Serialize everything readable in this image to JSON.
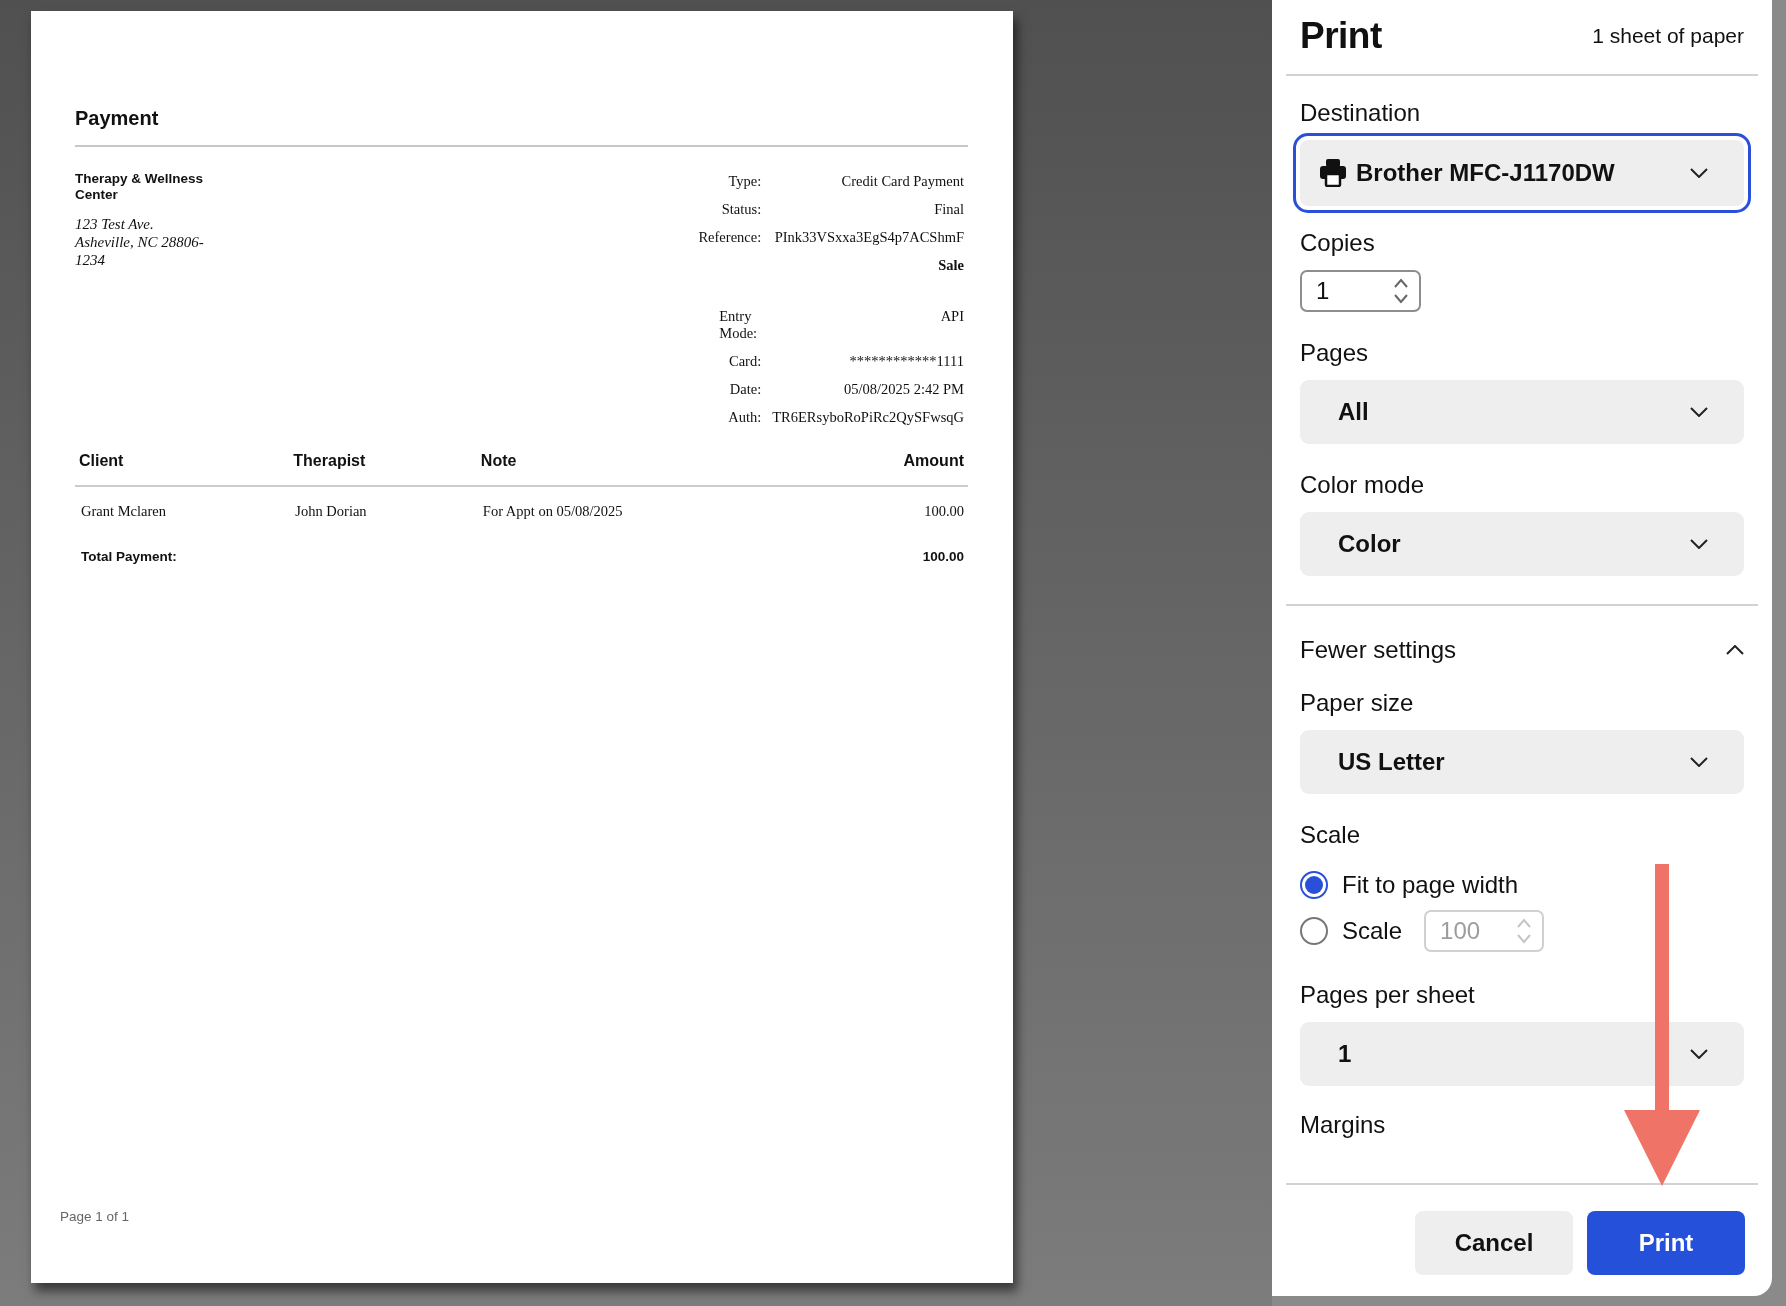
{
  "preview": {
    "document": {
      "title": "Payment",
      "business": {
        "name": "Therapy & Wellness Center",
        "address": [
          "123 Test Ave.",
          "Asheville, NC 28806-1234"
        ]
      },
      "details": [
        {
          "kind": "pair",
          "label": "Type:",
          "value": "Credit Card Payment"
        },
        {
          "kind": "pair",
          "label": "Status:",
          "value": "Final"
        },
        {
          "kind": "pair",
          "label": "Reference:",
          "value": "PInk33VSxxa3EgS4p7ACShmF"
        },
        {
          "kind": "heading",
          "value": "Sale"
        },
        {
          "kind": "pair",
          "label": "Entry Mode:",
          "value": "API"
        },
        {
          "kind": "pair",
          "label": "Card:",
          "value": "************1111"
        },
        {
          "kind": "pair",
          "label": "Date:",
          "value": "05/08/2025 2:42 PM"
        },
        {
          "kind": "pair",
          "label": "Auth:",
          "value": "TR6ERsyboRoPiRc2QySFwsqG"
        }
      ],
      "table": {
        "columns": [
          "Client",
          "Therapist",
          "Note",
          "Amount"
        ],
        "rows": [
          [
            "Grant Mclaren",
            "John Dorian",
            "For Appt on 05/08/2025",
            "100.00"
          ]
        ],
        "total": {
          "label": "Total Payment:",
          "value": "100.00"
        }
      },
      "footer": "Page 1 of 1"
    }
  },
  "panel": {
    "title": "Print",
    "sheet_count": "1 sheet of paper",
    "settings": [
      {
        "kind": "destination",
        "label": "Destination",
        "value": "Brother MFC-J1170DW",
        "focused": true
      },
      {
        "kind": "number",
        "label": "Copies",
        "value": "1"
      },
      {
        "kind": "select",
        "label": "Pages",
        "value": "All"
      },
      {
        "kind": "select",
        "label": "Color mode",
        "value": "Color"
      },
      {
        "kind": "toggle",
        "label": "Fewer settings",
        "expanded": true
      },
      {
        "kind": "select",
        "label": "Paper size",
        "value": "US Letter"
      },
      {
        "kind": "radio",
        "label": "Scale",
        "options": [
          {
            "label": "Fit to page width",
            "selected": true
          },
          {
            "label": "Scale",
            "selected": false,
            "value": "100",
            "disabled": true
          }
        ]
      },
      {
        "kind": "select",
        "label": "Pages per sheet",
        "value": "1"
      },
      {
        "kind": "label",
        "label": "Margins"
      }
    ],
    "buttons": [
      {
        "kind": "secondary",
        "label": "Cancel"
      },
      {
        "kind": "primary",
        "label": "Print"
      }
    ]
  }
}
